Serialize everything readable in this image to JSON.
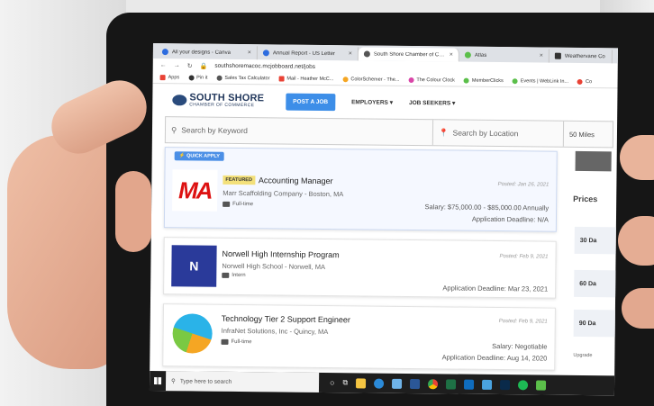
{
  "browser": {
    "tabs": [
      {
        "label": "All your designs - Canva",
        "color": "#2d6cdf",
        "active": false
      },
      {
        "label": "Annual Report - US Letter",
        "color": "#2d6cdf",
        "active": false
      },
      {
        "label": "South Shore Chamber of Com",
        "color": "#555555",
        "active": true
      },
      {
        "label": "Atlas",
        "color": "#5bbf4a",
        "active": false
      },
      {
        "label": "Weathervane Co",
        "color": "#333333",
        "active": false
      }
    ],
    "url": "southshoremacoc.mcjobboard.net/jobs",
    "bookmarks": [
      {
        "label": "Apps",
        "color": "#e94235"
      },
      {
        "label": "Pin it",
        "color": "#333333"
      },
      {
        "label": "Sales Tax Calculator",
        "color": "#555555"
      },
      {
        "label": "Mail - Heather McC...",
        "color": "#e94235"
      },
      {
        "label": "ColorSchemer - The...",
        "color": "#f5a623"
      },
      {
        "label": "The Colour Clock",
        "color": "#d946a8"
      },
      {
        "label": "MemberClicks",
        "color": "#5bbf4a"
      },
      {
        "label": "Events | WebLink In...",
        "color": "#5bbf4a"
      },
      {
        "label": "Co",
        "color": "#e94235"
      }
    ]
  },
  "site": {
    "logo_big": "SOUTH SHORE",
    "logo_small": "CHAMBER OF COMMERCE",
    "post_job": "POST A JOB",
    "employers": "EMPLOYERS",
    "job_seekers": "JOB SEEKERS"
  },
  "search": {
    "keyword_placeholder": "Search by Keyword",
    "location_placeholder": "Search by Location",
    "radius": "50 Miles"
  },
  "jobs": [
    {
      "quick_apply": "QUICK APPLY",
      "featured": "FEATURED",
      "logo_text": "MA",
      "title": "Accounting Manager",
      "company": "Marr Scaffolding Company - Boston, MA",
      "type": "Full-time",
      "posted": "Posted: Jan 26, 2021",
      "salary": "Salary: $75,000.00 - $85,000.00 Annually",
      "deadline": "Application Deadline: N/A"
    },
    {
      "logo_text": "N",
      "title": "Norwell High Internship Program",
      "company": "Norwell High School - Norwell, MA",
      "type": "Intern",
      "posted": "Posted: Feb 9, 2021",
      "deadline": "Application Deadline: Mar 23, 2021"
    },
    {
      "title": "Technology Tier 2 Support Engineer",
      "company": "InfraNet Solutions, Inc - Quincy, MA",
      "type": "Full-time",
      "posted": "Posted: Feb 9, 2021",
      "salary": "Salary: Negotiable",
      "deadline": "Application Deadline: Aug 14, 2020"
    }
  ],
  "sidebar": {
    "prices_title": "Prices",
    "price_items": [
      "30 Da",
      "60 Da",
      "90 Da"
    ],
    "upgrade": "Upgrade"
  },
  "taskbar": {
    "search_placeholder": "Type here to search"
  }
}
